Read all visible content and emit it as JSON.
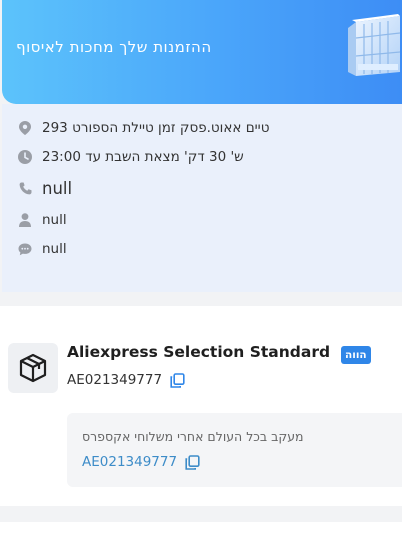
{
  "banner": {
    "title": "ההזמנות שלך מחכות לאיסוף",
    "icon": "parcel-locker-icon"
  },
  "pickup_point": {
    "address": "טיים אאוט.פסק זמן טיילת הספורט 293",
    "hours": "ש' 30 דק' מצאת השבת עד 23:00",
    "phone": "null",
    "contact_name": "null",
    "note": "null"
  },
  "shipment": {
    "carrier": "Aliexpress Selection Standard",
    "status_badge": "הווה",
    "tracking_number": "AE021349777",
    "tracking_description": "מעקב בכל העולם אחרי משלוחי אקספרס",
    "tracking_link": "AE021349777"
  },
  "colors": {
    "banner_start": "#5cc3fb",
    "banner_end": "#3d8df5",
    "badge": "#2f86e8",
    "link": "#3d8cc8",
    "icon_gray": "#9a9ea6"
  }
}
